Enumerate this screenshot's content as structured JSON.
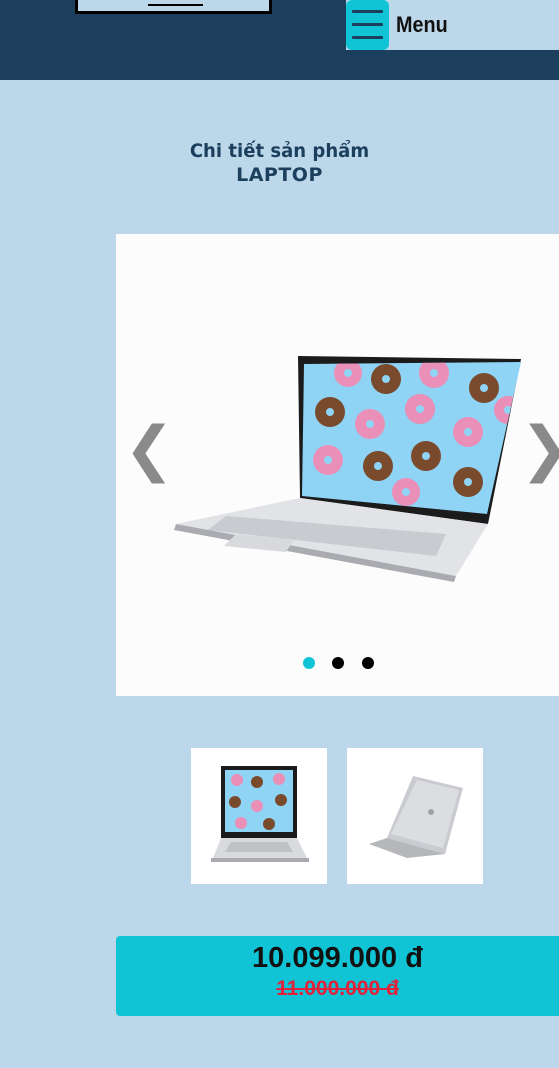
{
  "header": {
    "menu_label": "Menu"
  },
  "page": {
    "subtitle": "Chi tiết sản phẩm",
    "title": "LAPTOP"
  },
  "carousel": {
    "prev_icon": "chevron-left-icon",
    "next_icon": "chevron-right-icon",
    "prev_glyph": "❮",
    "next_glyph": "❯",
    "slide_count": 3,
    "active_slide": 1,
    "main_image": "acer laptop with donut wallpaper, front view"
  },
  "thumbnails": [
    {
      "image": "acer laptop front view with donut wallpaper"
    },
    {
      "image": "acer laptop rear view, silver lid"
    }
  ],
  "price": {
    "current": "10.099.000 đ",
    "original": "11.000.000 đ"
  },
  "colors": {
    "header_bg": "#1b3f5c",
    "page_bg": "#bcd6ea",
    "accent": "#10c4d6",
    "old_price": "#e0223a"
  }
}
